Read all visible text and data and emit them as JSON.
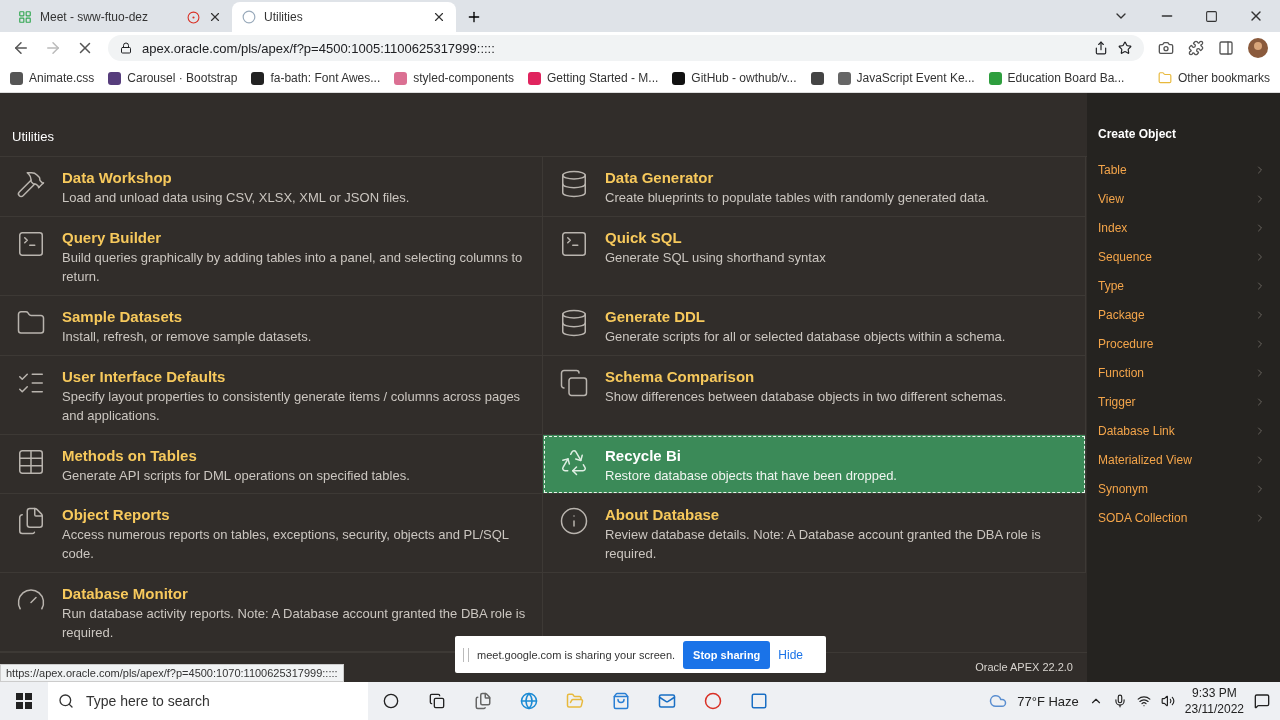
{
  "browser": {
    "tabs": [
      {
        "title": "Meet - sww-ftuo-dez",
        "selected": false,
        "kind": "meet"
      },
      {
        "title": "Utilities",
        "selected": true,
        "kind": "loading"
      }
    ],
    "url": "apex.oracle.com/pls/apex/f?p=4500:1005:1100625317999:::::",
    "bookmarks": [
      {
        "label": "Animate.css",
        "color": "#555555"
      },
      {
        "label": "Carousel · Bootstrap",
        "color": "#563d7c"
      },
      {
        "label": "fa-bath: Font Awes...",
        "color": "#222222"
      },
      {
        "label": "styled-components",
        "color": "#db7093"
      },
      {
        "label": "Getting Started - M...",
        "color": "#e0245e"
      },
      {
        "label": "GitHub - owthub/v...",
        "color": "#111111"
      },
      {
        "color": "#444444"
      },
      {
        "label": "JavaScript Event Ke...",
        "color": "#666666"
      },
      {
        "label": "Education Board Ba...",
        "color": "#2e9e3e"
      }
    ],
    "other_bookmarks": "Other bookmarks"
  },
  "page": {
    "header": "Utilities",
    "utilities": [
      {
        "title": "Data Workshop",
        "description": "Load and unload data using CSV, XLSX, XML or JSON files.",
        "kind": "hammer",
        "selected": false
      },
      {
        "title": "Data Generator",
        "description": "Create blueprints to populate tables with randomly generated data.",
        "kind": "database-file",
        "selected": false
      },
      {
        "title": "Query Builder",
        "description": "Build queries graphically by adding tables into a panel, and selecting columns to return.",
        "kind": "terminal",
        "selected": false
      },
      {
        "title": "Quick SQL",
        "description": "Generate SQL using shorthand syntax",
        "kind": "terminal",
        "selected": false
      },
      {
        "title": "Sample Datasets",
        "description": "Install, refresh, or remove sample datasets.",
        "kind": "folder",
        "selected": false
      },
      {
        "title": "Generate DDL",
        "description": "Generate scripts for all or selected database objects within a schema.",
        "kind": "database-file",
        "selected": false
      },
      {
        "title": "User Interface Defaults",
        "description": "Specify layout properties to consistently generate items / columns across pages and applications.",
        "kind": "list",
        "selected": false
      },
      {
        "title": "Schema Comparison",
        "description": "Show differences between database objects in two different schemas.",
        "kind": "compare",
        "selected": false
      },
      {
        "title": "Methods on Tables",
        "description": "Generate API scripts for DML operations on specified tables.",
        "kind": "table",
        "selected": false
      },
      {
        "title": "Recycle Bi",
        "description": "Restore database objects that have been dropped.",
        "kind": "recycle",
        "selected": true
      },
      {
        "title": "Object Reports",
        "description": "Access numerous reports on tables, exceptions, security, objects and PL/SQL code.",
        "kind": "files",
        "selected": false
      },
      {
        "title": "About Database",
        "description": "Review database details. Note: A Database account granted the DBA role is required.",
        "kind": "database-info",
        "selected": false
      },
      {
        "title": "Database Monitor",
        "description": "Run database activity reports. Note: A Database account granted the DBA role is required.",
        "kind": "gauge",
        "selected": false
      }
    ],
    "sidebar": {
      "title": "Create Object",
      "items": [
        "Table",
        "View",
        "Index",
        "Sequence",
        "Type",
        "Package",
        "Procedure",
        "Function",
        "Trigger",
        "Database Link",
        "Materialized View",
        "Synonym",
        "SODA Collection"
      ]
    },
    "version": "Oracle APEX 22.2.0",
    "status_url": "https://apex.oracle.com/pls/apex/f?p=4500:1070:1100625317999:::::"
  },
  "share_bar": {
    "message": "meet.google.com is sharing your screen.",
    "stop": "Stop sharing",
    "hide": "Hide"
  },
  "taskbar": {
    "search_placeholder": "Type here to search",
    "weather": "77°F  Haze",
    "time": "9:33 PM",
    "date": "23/11/2022"
  }
}
